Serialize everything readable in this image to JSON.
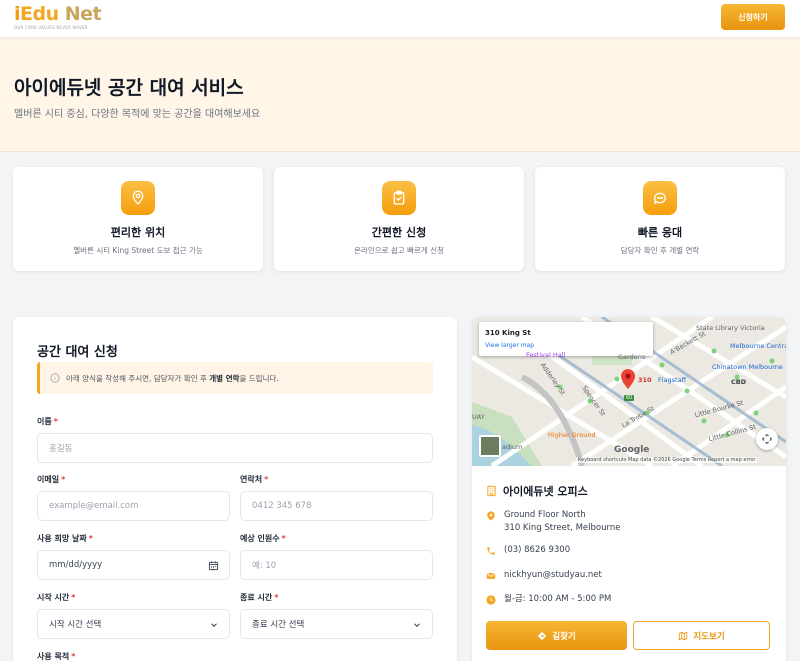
{
  "header": {
    "logo_i": "i",
    "logo_edu": "Edu",
    "logo_net": " Net",
    "logo_tagline": "OUR CORE VALUES NEVER WAVER",
    "apply_label": "신청하기"
  },
  "hero": {
    "title": "아이에듀넷 공간 대여 서비스",
    "subtitle": "멜버른 시티 중심, 다양한 목적에 맞는 공간을 대여해보세요"
  },
  "features": [
    {
      "icon": "location-pin-icon",
      "title": "편리한 위치",
      "desc": "멜버른 시티 King Street 도보 접근 가능"
    },
    {
      "icon": "clipboard-check-icon",
      "title": "간편한 신청",
      "desc": "온라인으로 쉽고 빠르게 신청"
    },
    {
      "icon": "chat-bubble-icon",
      "title": "빠른 응대",
      "desc": "담당자 확인 후 개별 연락"
    }
  ],
  "form": {
    "title": "공간 대여 신청",
    "notice_pre": "아래 양식을 작성해 주시면, 담당자가 확인 후 ",
    "notice_bold": "개별 연락",
    "notice_post": "을 드립니다.",
    "required_mark": "*",
    "name_label": "이름",
    "name_placeholder": "홍길동",
    "email_label": "이메일",
    "email_placeholder": "example@email.com",
    "phone_label": "연락처",
    "phone_placeholder": "0412 345 678",
    "date_label": "사용 희망 날짜",
    "date_value": "mm/dd/yyyy",
    "people_label": "예상 인원수",
    "people_placeholder": "예: 10",
    "start_label": "시작 시간",
    "start_value": "시작 시간 선택",
    "end_label": "종료 시간",
    "end_value": "종료 시간 선택",
    "purpose_label": "사용 목적"
  },
  "map": {
    "place_title": "310 King St",
    "larger_link": "View larger map",
    "labels": {
      "state_library": "State Library Victoria",
      "melbourne_central": "Melbourne Central",
      "chinatown": "Chinatown Melbourne",
      "cbd": "CBD",
      "flagstaff": "Flagstaff",
      "pin_label": "310",
      "festival_hall": "Festival Hall",
      "gardens": "Gardens",
      "higher_ground": "Higher Ground",
      "stadium": "adium",
      "uay": "UAY",
      "little_bourke": "Little Bourke St",
      "little_collins": "Little Collins St",
      "spencer_st": "Spencer St",
      "addeley_st": "Adderley St",
      "la_trobe": "La Trobe St",
      "beckett": "A'Beckett St",
      "road_num": "60"
    },
    "google": "Google",
    "footer": "Keyboard shortcuts    Map data ©2026 Google    Terms    Report a map error"
  },
  "office": {
    "title": "아이에듀넷 오피스",
    "address_line1": "Ground Floor North",
    "address_line2": "310 King Street, Melbourne",
    "phone": "(03) 8626 9300",
    "email": "nickhyun@studyau.net",
    "hours": "월-금: 10:00 AM - 5:00 PM",
    "directions_label": "길찾기",
    "mapview_label": "지도보기"
  },
  "colors": {
    "accent": "#f5a623",
    "accent_dark": "#e8940f",
    "hero_bg": "#fff6e8",
    "required": "#e23b3b"
  }
}
